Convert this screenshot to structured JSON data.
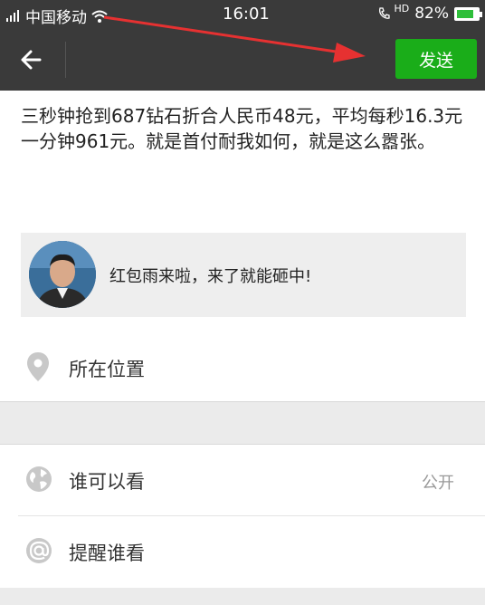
{
  "status_bar": {
    "carrier": "中国移动",
    "time": "16:01",
    "network": "HD",
    "battery_percent": "82%",
    "battery_level": 0.82
  },
  "nav": {
    "send_label": "发送",
    "accent": "#1aad19"
  },
  "post": {
    "text": "三秒钟抢到687钻石折合人民币48元，平均每秒16.3元一分钟961元。就是首付耐我如何，就是这么嚣张。"
  },
  "share_card": {
    "title": "红包雨来啦，来了就能砸中!"
  },
  "location": {
    "label": "所在位置",
    "icon": "location-pin-icon"
  },
  "visibility": {
    "label": "谁可以看",
    "value": "公开",
    "icon": "globe-icon"
  },
  "mention": {
    "label": "提醒谁看",
    "icon": "at-icon"
  }
}
